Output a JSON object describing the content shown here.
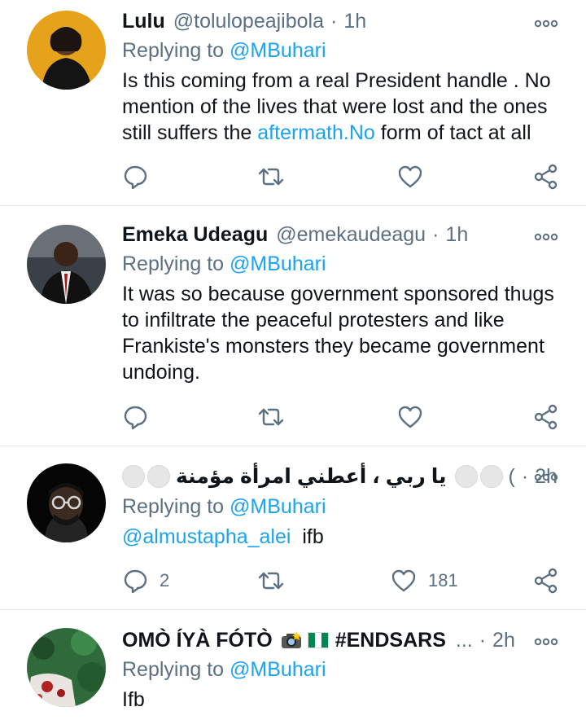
{
  "colors": {
    "accent": "#1da1f2",
    "secondary_text": "#5b7083",
    "divider": "#e1e8ed"
  },
  "tweets": [
    {
      "name": "Lulu",
      "handle": "@tolulopeajibola",
      "time": "1h",
      "replying_prefix": "Replying to",
      "replying_to": "@MBuhari",
      "text_part1": "Is this coming from a real President handle . No mention of the lives that were lost and the ones still suffers the ",
      "text_link": "aftermath.No",
      "text_part2": " form of tact at all",
      "reply_count": "",
      "retweet_count": "",
      "like_count": ""
    },
    {
      "name": "Emeka Udeagu",
      "handle": "@emekaudeagu",
      "time": "1h",
      "replying_prefix": "Replying to",
      "replying_to": "@MBuhari",
      "text": "It was so because government sponsored thugs to infiltrate the peaceful protesters and like Frankiste's monsters they became government undoing.",
      "reply_count": "",
      "retweet_count": "",
      "like_count": ""
    },
    {
      "name": "يا ربي ، أعطني امرأة مؤمنة",
      "handle": "(",
      "time": "2h",
      "replying_prefix": "Replying to",
      "replying_to": "@MBuhari",
      "text_mention": "@almustapha_alei",
      "text": "ifb",
      "reply_count": "2",
      "retweet_count": "",
      "like_count": "181"
    },
    {
      "name": "OMÒ ÍYÀ FÓTÒ",
      "name_tag": "#ENDSARS",
      "name_ellipsis": "...",
      "time": "2h",
      "replying_prefix": "Replying to",
      "replying_to": "@MBuhari",
      "text": "Ifb"
    }
  ],
  "icons": [
    "more-icon",
    "reply-icon",
    "retweet-icon",
    "like-icon",
    "share-icon",
    "camera-flash-emoji",
    "nigeria-flag-emoji"
  ]
}
